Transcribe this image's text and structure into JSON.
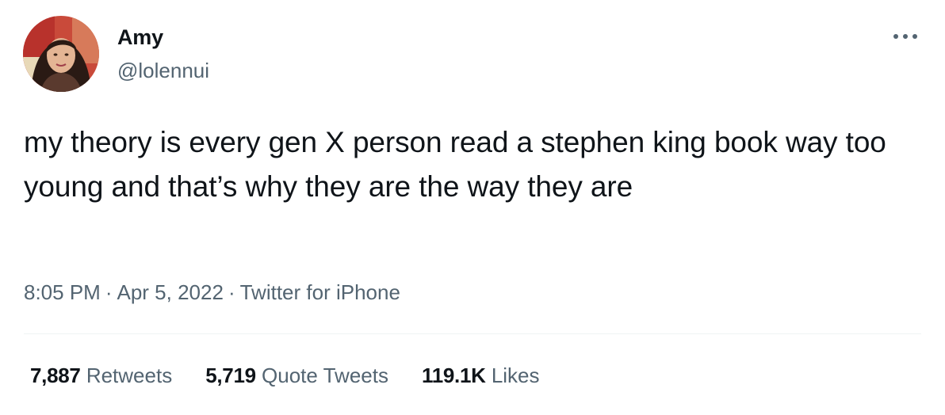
{
  "user": {
    "display_name": "Amy",
    "handle": "@lolennui",
    "avatar_icon": "profile-photo"
  },
  "tweet": {
    "text": "my theory is every gen X person read a stephen king book way too young and that’s why they are the way they are"
  },
  "meta": {
    "time": "8:05 PM",
    "date": "Apr 5, 2022",
    "source": "Twitter for iPhone",
    "separator": "·"
  },
  "stats": {
    "retweets_count": "7,887",
    "retweets_label": "Retweets",
    "quotes_count": "5,719",
    "quotes_label": "Quote Tweets",
    "likes_count": "119.1K",
    "likes_label": "Likes"
  },
  "menu": {
    "icon": "more-horizontal-icon"
  },
  "colors": {
    "text": "#0f1419",
    "secondary": "#536471",
    "divider": "#eff3f4"
  }
}
